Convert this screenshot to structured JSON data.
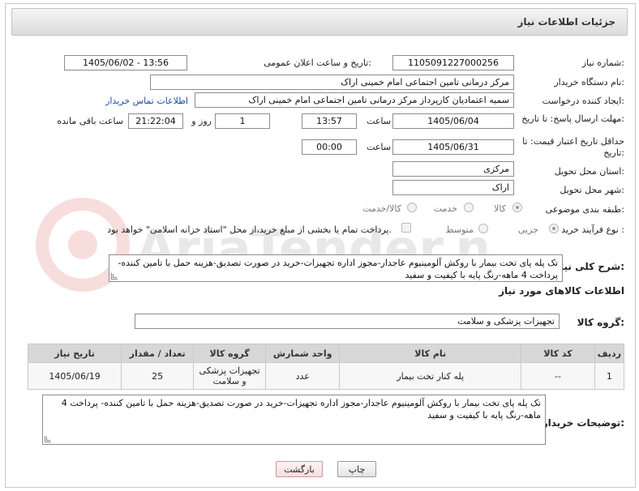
{
  "header": {
    "title": "جزئیات اطلاعات نیاز"
  },
  "watermark": {
    "text": "AriaTender.net"
  },
  "need_number": {
    "label": "شماره نیاز:",
    "value": "1105091227000256"
  },
  "announce": {
    "label": "تاریخ و ساعت اعلان عمومی:",
    "value": "1405/06/02 - 13:56"
  },
  "buyer_org": {
    "label": "نام دستگاه خریدار:",
    "value": "مرکز درمانی تامین اجتماعی امام خمینی اراک"
  },
  "requester": {
    "label": "ایجاد کننده درخواست:",
    "value": "سمیه اعتمادیان کارپرداز مرکز درمانی تامین اجتماعی امام خمینی اراک",
    "contact_link": "اطلاعات تماس خریدار"
  },
  "deadline": {
    "label": "مهلت ارسال پاسخ: تا تاریخ:",
    "date": "1405/06/04",
    "time_label": "ساعت",
    "time": "13:57",
    "days": "1",
    "days_label": "روز و",
    "remaining": "21:22:04",
    "remaining_label": "ساعت باقی مانده"
  },
  "price_validity": {
    "label": "حداقل تاریخ اعتبار قیمت: تا تاریخ:",
    "date": "1405/06/31",
    "time_label": "ساعت",
    "time": "00:00"
  },
  "province": {
    "label": "استان محل تحویل:",
    "value": "مرکزی"
  },
  "city": {
    "label": "شهر محل تحویل:",
    "value": "اراک"
  },
  "category": {
    "label": "طبقه بندی موضوعی:",
    "options": [
      "کالا",
      "خدمت",
      "کالا/خدمت"
    ],
    "selected": "کالا"
  },
  "process": {
    "label": "نوع فرآیند خرید :",
    "options": [
      "جزیی",
      "متوسط"
    ],
    "selected": "جزیی",
    "payment_note": "پرداخت تمام یا بخشی از مبلغ خرید،از محل \"اسناد خزانه اسلامی\" خواهد بود."
  },
  "description": {
    "label": "شرح کلی نیاز:",
    "value": "تک پله پای تخت بیمار با روکش آلومینیوم عاجدار-مجوز اداره تجهیزات-خرید در صورت تصدیق-هزینه حمل با تامین کننده- پرداخت 4 ماهه-رنگ پایه با کیفیت و سفید"
  },
  "goods_info": {
    "title": "اطلاعات کالاهای مورد نیاز"
  },
  "goods_group": {
    "label": "گروه کالا:",
    "value": "تجهیزات پزشکی و سلامت"
  },
  "table": {
    "headers": [
      "ردیف",
      "کد کالا",
      "نام کالا",
      "واحد شمارش",
      "گروه کالا",
      "تعداد / مقدار",
      "تاریخ نیاز"
    ],
    "rows": [
      [
        "1",
        "--",
        "پله کنار تخت بیمار",
        "عدد",
        "تجهیزات پزشکی و سلامت",
        "25",
        "1405/06/19"
      ]
    ]
  },
  "buyer_notes": {
    "label": "توضیحات خریدار:",
    "value": "تک پله پای تخت بیمار با روکش آلومینیوم عاجدار-مجوز اداره تجهیزات-خرید در صورت تصدیق-هزینه حمل با تامین کننده- پرداخت 4 ماهه-رنگ پایه با کیفیت و سفید"
  },
  "buttons": {
    "print": "چاپ",
    "back": "بازگشت"
  }
}
